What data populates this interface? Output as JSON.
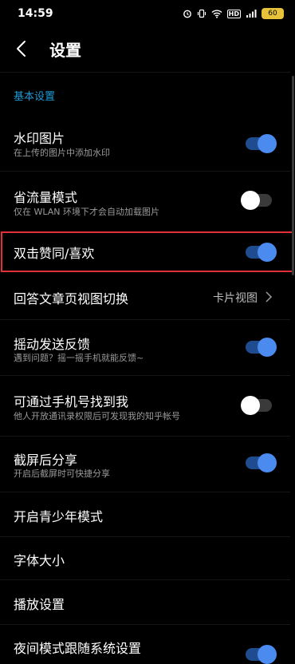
{
  "status_bar": {
    "time": "14:59",
    "icons": [
      "alarm-icon",
      "vibrate-icon",
      "wifi-icon",
      "hd-icon",
      "signal-icon"
    ],
    "hd_label": "HD",
    "battery": "60"
  },
  "header": {
    "title": "设置"
  },
  "section": {
    "basic_title": "基本设置"
  },
  "settings": {
    "watermark": {
      "title": "水印图片",
      "subtitle": "在上传的图片中添加水印",
      "enabled": true
    },
    "data_saver": {
      "title": "省流量模式",
      "subtitle": "仅在 WLAN 环境下才会自动加载图片",
      "enabled": false
    },
    "double_tap": {
      "title": "双击赞同/喜欢",
      "enabled": true
    },
    "answer_view": {
      "title": "回答文章页视图切换",
      "value": "卡片视图"
    },
    "shake_feedback": {
      "title": "摇动发送反馈",
      "subtitle": "遇到问题？摇一摇手机就能反馈~",
      "enabled": true
    },
    "find_by_phone": {
      "title": "可通过手机号找到我",
      "subtitle": "他人开放通讯录权限后可发现我的知乎帐号",
      "enabled": false
    },
    "screenshot_share": {
      "title": "截屏后分享",
      "subtitle": "开启后截屏时可快捷分享",
      "enabled": true
    },
    "youth_mode": {
      "title": "开启青少年模式"
    },
    "font_size": {
      "title": "字体大小"
    },
    "playback": {
      "title": "播放设置"
    },
    "night_follow_system": {
      "title": "夜间模式跟随系统设置",
      "enabled": true
    }
  },
  "colors": {
    "accent": "#1e9bd7",
    "toggle_on": "#4b8bf0",
    "highlight": "#e0303a"
  }
}
